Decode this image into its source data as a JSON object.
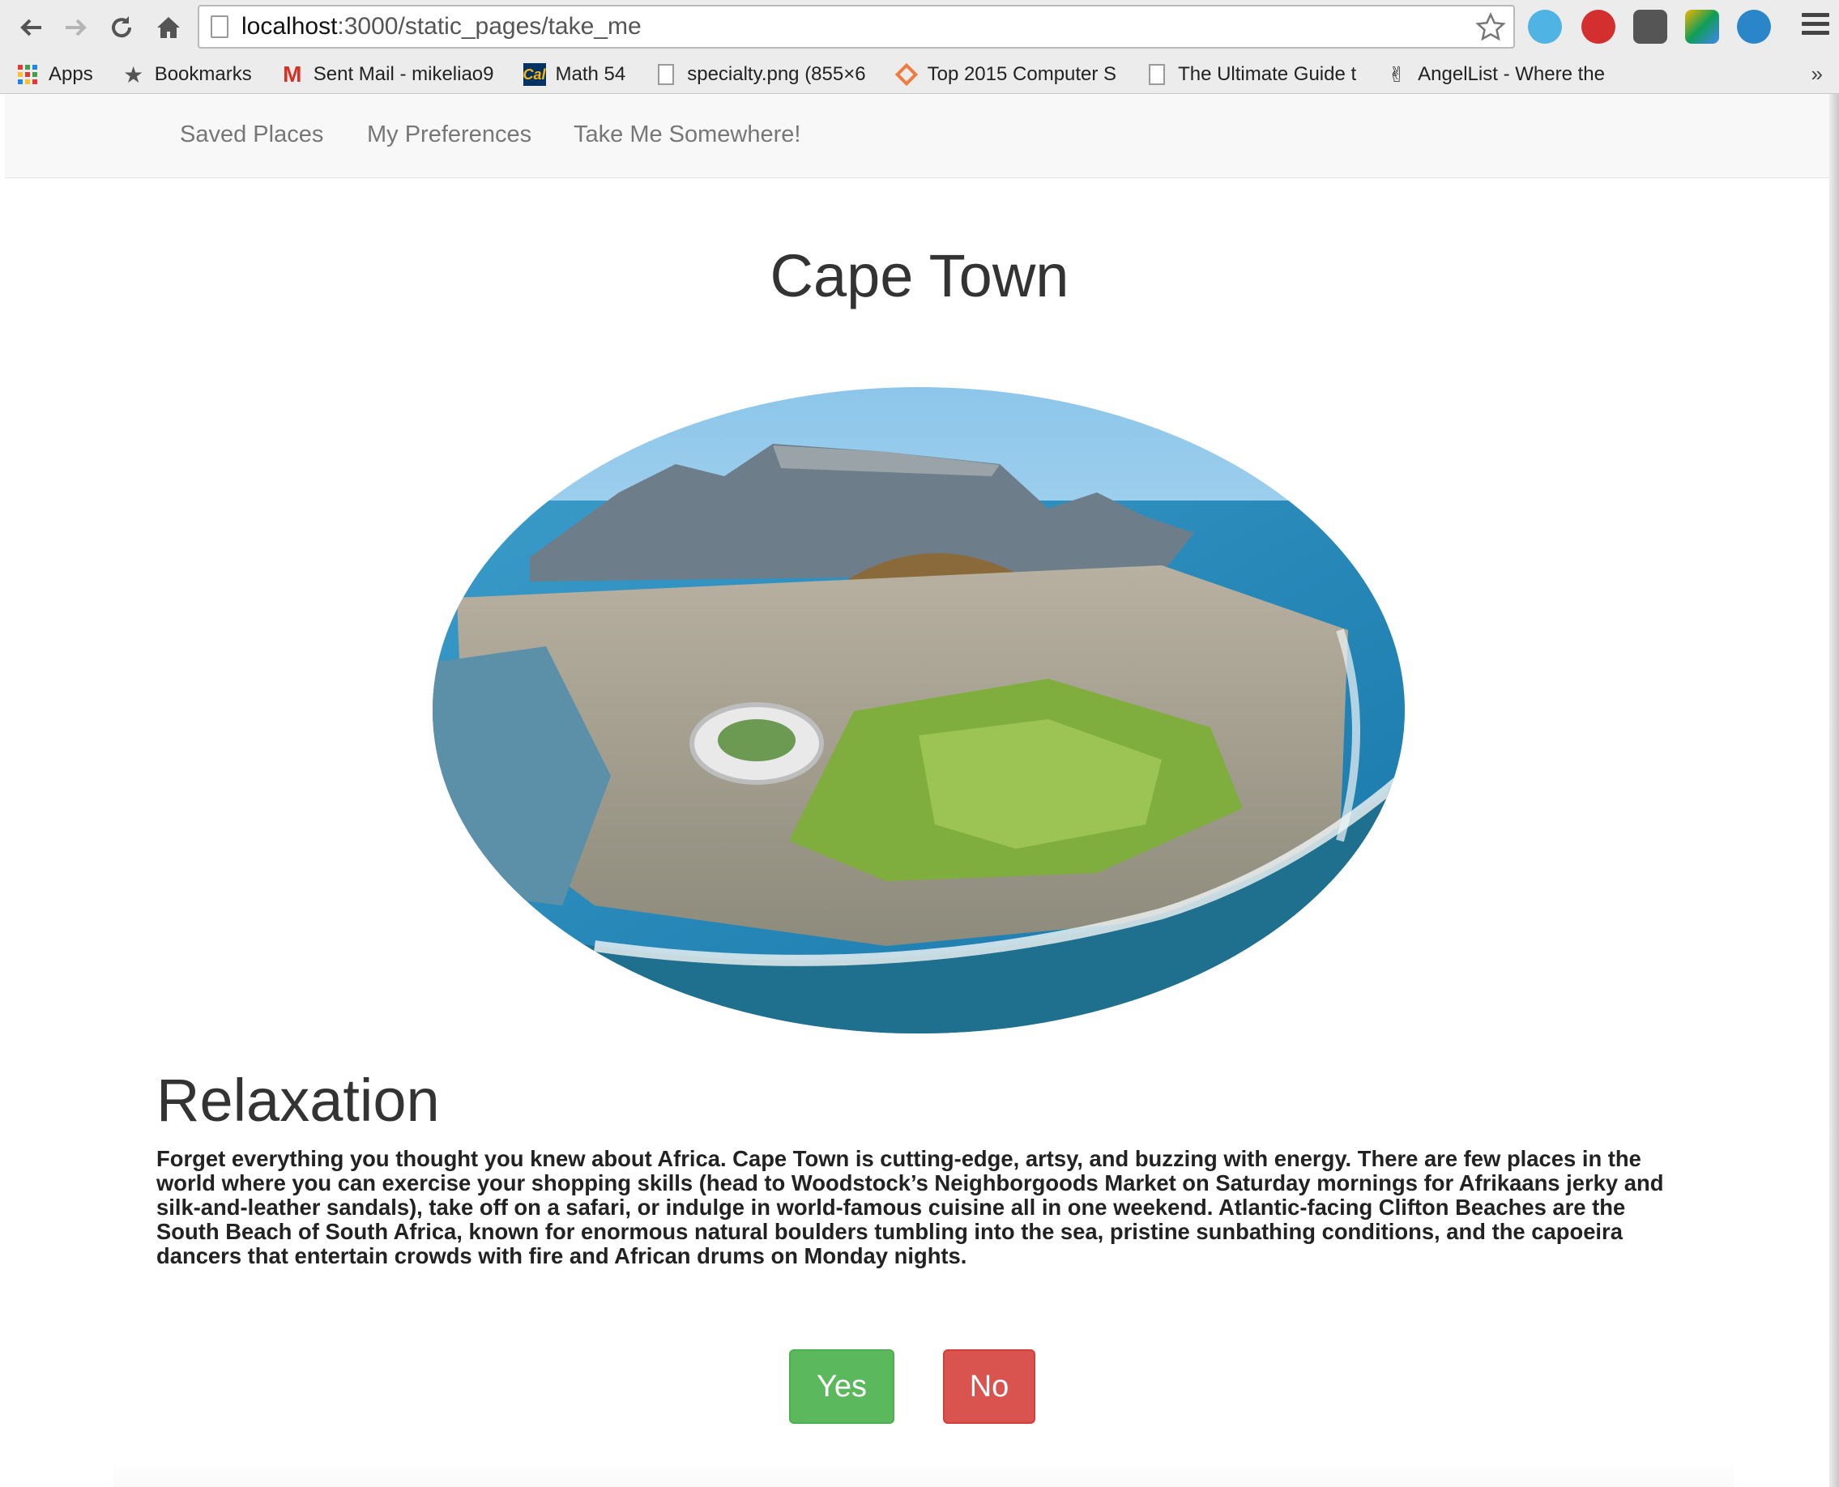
{
  "browser": {
    "url_host": "localhost",
    "url_rest": ":3000/static_pages/take_me",
    "bookmarks": [
      {
        "label": "Apps",
        "icon": "apps-grid-icon"
      },
      {
        "label": "Bookmarks",
        "icon": "star-icon"
      },
      {
        "label": "Sent Mail - mikeliao9",
        "icon": "gmail-icon"
      },
      {
        "label": "Math 54",
        "icon": "cal-icon"
      },
      {
        "label": "specialty.png (855×6",
        "icon": "file-icon"
      },
      {
        "label": "Top 2015 Computer S",
        "icon": "diamond-icon"
      },
      {
        "label": "The Ultimate Guide t",
        "icon": "file-icon"
      },
      {
        "label": "AngelList - Where the",
        "icon": "hand-icon"
      }
    ],
    "more": "»"
  },
  "navbar": {
    "links": [
      "Saved Places",
      "My Preferences",
      "Take Me Somewhere!"
    ]
  },
  "place": {
    "name": "Cape Town",
    "category": "Relaxation",
    "description": "Forget everything you thought you knew about Africa. Cape Town is cutting-edge, artsy, and buzzing with energy. There are few places in the world where you can exercise your shopping skills (head to Woodstock’s Neighborgoods Market on Saturday mornings for Afrikaans jerky and silk-and-leather sandals), take off on a safari, or indulge in world-famous cuisine all in one weekend. Atlantic-facing Clifton Beaches are the South Beach of South Africa, known for enormous natural boulders tumbling into the sea, pristine sunbathing conditions, and the capoeira dancers that entertain crowds with fire and African drums on Monday nights."
  },
  "actions": {
    "yes": "Yes",
    "no": "No"
  },
  "colors": {
    "yes": "#5cb85c",
    "no": "#d9534f",
    "navbar_bg": "#f8f8f8"
  }
}
